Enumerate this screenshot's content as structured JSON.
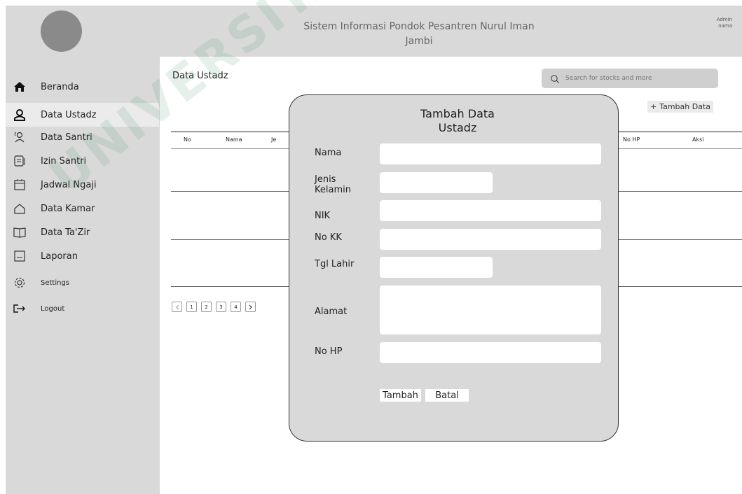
{
  "header": {
    "app_title": "Sistem Informasi Pondok Pesantren Nurul Iman Jambi",
    "admin_line1": "Admin",
    "admin_line2": "nama"
  },
  "sidebar": {
    "items": [
      {
        "label": "Beranda",
        "icon": "home-icon"
      },
      {
        "label": "Data Ustadz",
        "icon": "user-icon",
        "active": true
      },
      {
        "label": "Data Santri",
        "icon": "users-icon"
      },
      {
        "label": "Izin Santri",
        "icon": "document-icon"
      },
      {
        "label": "Jadwal Ngaji",
        "icon": "calendar-icon"
      },
      {
        "label": "Data Kamar",
        "icon": "house-outline-icon"
      },
      {
        "label": "Data Ta'Zir",
        "icon": "book-icon"
      },
      {
        "label": "Laporan",
        "icon": "report-icon"
      },
      {
        "label": "Settings",
        "icon": "gear-icon"
      },
      {
        "label": "Logout",
        "icon": "logout-icon"
      }
    ]
  },
  "main": {
    "page_title": "Data Ustadz",
    "search_placeholder": "Search for stocks and more",
    "add_button": "Tambah Data",
    "table_headers": [
      "No",
      "Nama",
      "Je",
      "No HP",
      "Aksi"
    ],
    "pagination": [
      "1",
      "2",
      "3",
      "4"
    ]
  },
  "watermark": "UNIVERSITAS JA YOG",
  "modal": {
    "title_line1": "Tambah Data",
    "title_line2": "Ustadz",
    "fields": {
      "nama": "Nama",
      "jenis_kelamin_1": "Jenis",
      "jenis_kelamin_2": "Kelamin",
      "nik": "NIK",
      "no_kk": "No KK",
      "tgl_lahir": "Tgl Lahir",
      "alamat": "Alamat",
      "no_hp": "No HP"
    },
    "submit": "Tambah",
    "cancel": "Batal"
  },
  "colors": {
    "panel_gray": "#d9d9d9",
    "watermark_green": "#2e8b57"
  }
}
